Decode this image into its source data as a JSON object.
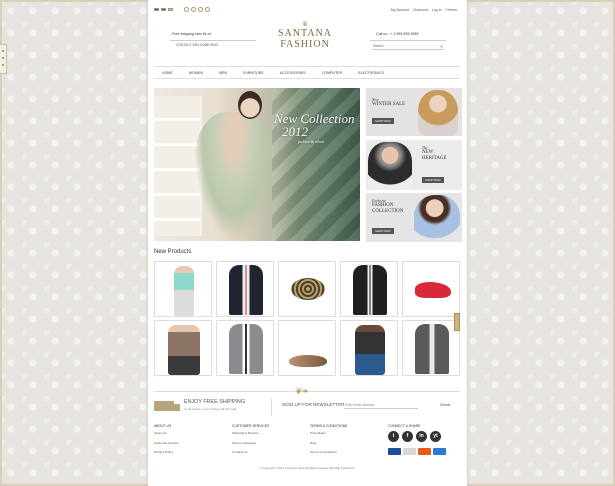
{
  "topbar": {
    "flags": [
      "#2f4fa0",
      "#c23a30",
      "#e0b040"
    ],
    "social_icons": [
      "twitter-icon",
      "facebook-icon",
      "linkedin-icon",
      "pinterest-icon"
    ],
    "links": [
      "My Account",
      "Checkout",
      "Log In",
      "0 Items"
    ]
  },
  "header": {
    "shipping": "Free shipping over $x.xx",
    "contact_label": "CONTACT WELCOME MSG",
    "logo_line1": "SANTANA",
    "logo_line2": "FASHION",
    "callus": "Call us : + 1 555-555-5555",
    "search_placeholder": "Search"
  },
  "nav": [
    "Home",
    "Women",
    "Men",
    "Furniture",
    "Accessories",
    "Computer",
    "Electronics"
  ],
  "hero": {
    "line1": "New Collection",
    "line2": "2012",
    "line3": "fashion & ethnic"
  },
  "promos": [
    {
      "kicker": "New",
      "title": "WINTER SALE",
      "button": "Shop now"
    },
    {
      "kicker": "The",
      "title": "NEW HERITAGE",
      "button": "Shop now"
    },
    {
      "kicker": "Exclusive",
      "title": "FASHION COLLECTION",
      "button": "Shop now"
    }
  ],
  "products": {
    "title": "New Products",
    "items": [
      "mint-top",
      "navy-suit",
      "studded-bracelet",
      "black-suit",
      "red-heels",
      "brown-knit",
      "grey-suit",
      "flat-shoes",
      "dark-tee",
      "grey-blazer"
    ]
  },
  "footer": {
    "shipping_title": "ENJOY FREE SHIPPING",
    "shipping_sub": "on all orders or our holiday gift this year",
    "newsletter_title": "SIGN UP FOR NEWSLETTER",
    "newsletter_placeholder": "Enter email address",
    "newsletter_button": "Submit",
    "cols": [
      {
        "title": "About Us",
        "links": [
          "About Us",
          "Customer Service",
          "Privacy Policy"
        ]
      },
      {
        "title": "Customer Services",
        "links": [
          "Shipping & Returns",
          "Secure Shopping",
          "Contact Us"
        ]
      },
      {
        "title": "Terms & Conditions",
        "links": [
          "Price Rules",
          "Help",
          "Terms & Conditions"
        ]
      }
    ],
    "connect_title": "Connect & Share",
    "social": [
      "t",
      "f",
      "in",
      "yt"
    ],
    "payments": [
      "#1a4d9c",
      "#d8d8d8",
      "#e85a1c",
      "#2a7ad0"
    ],
    "copyright": "© Copyright © 2014 Company name All rights reserved. Site Map Contact Us"
  },
  "colors": {
    "accent": "#b89a5a",
    "logo": "#7a6a48"
  }
}
